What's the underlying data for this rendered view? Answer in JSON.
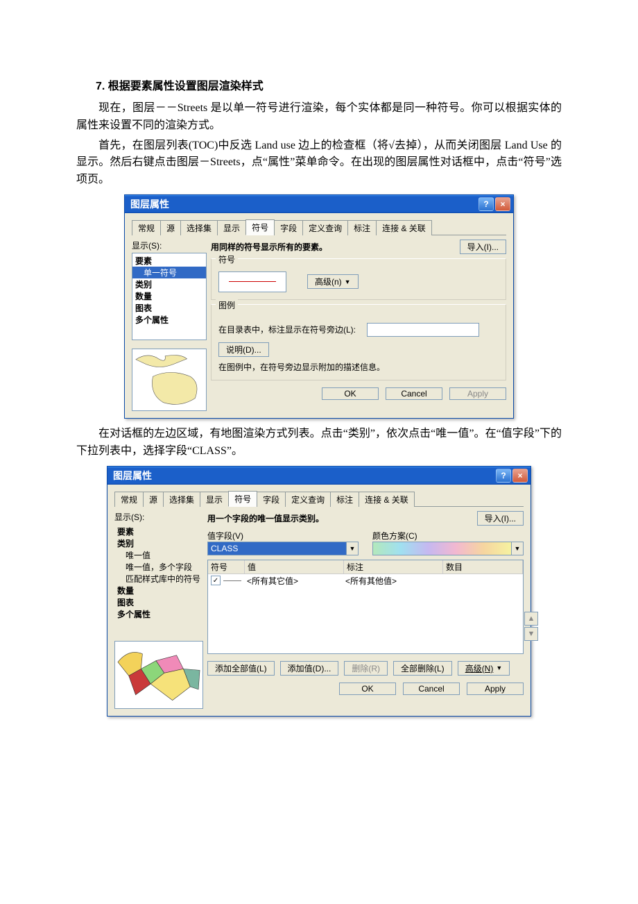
{
  "heading": "7. 根据要素属性设置图层渲染样式",
  "para1": "现在，图层－－Streets 是以单一符号进行渲染，每个实体都是同一种符号。你可以根据实体的属性来设置不同的渲染方式。",
  "para2": "首先，在图层列表(TOC)中反选 Land use 边上的检查框（将√去掉），从而关闭图层 Land Use 的显示。然后右键点击图层－Streets，点“属性”菜单命令。在出现的图层属性对话框中，点击“符号”选项页。",
  "para3": "在对话框的左边区域，有地图渲染方式列表。点击“类别”，依次点击“唯一值”。在“值字段”下的下拉列表中，选择字段“CLASS”。",
  "dialog1": {
    "title": "图层属性",
    "help": "?",
    "close": "×",
    "tabs": [
      "常规",
      "源",
      "选择集",
      "显示",
      "符号",
      "字段",
      "定义查询",
      "标注",
      "连接 & 关联"
    ],
    "active_tab": 4,
    "show_label": "显示(S):",
    "side_items": [
      "要素",
      "单一符号",
      "类别",
      "数量",
      "图表",
      "多个属性"
    ],
    "side_selected": 1,
    "desc": "用同样的符号显示所有的要素。",
    "import_btn": "导入(I)...",
    "group_symbol": "符号",
    "advanced_btn": "高级(n)",
    "group_legend": "图例",
    "legend_text": "在目录表中，标注显示在符号旁边(L):",
    "desc_btn": "说明(D)...",
    "legend_note": "在图例中，在符号旁边显示附加的描述信息。",
    "ok": "OK",
    "cancel": "Cancel",
    "apply": "Apply"
  },
  "dialog2": {
    "title": "图层属性",
    "help": "?",
    "close": "×",
    "tabs": [
      "常规",
      "源",
      "选择集",
      "显示",
      "符号",
      "字段",
      "定义查询",
      "标注",
      "连接 & 关联"
    ],
    "active_tab": 4,
    "show_label": "显示(S):",
    "side_items": [
      "要素",
      "类别",
      "唯一值",
      "唯一值，多个字段",
      "匹配样式库中的符号",
      "数量",
      "图表",
      "多个属性"
    ],
    "side_bold": [
      0,
      1,
      5,
      6,
      7
    ],
    "desc": "用一个字段的唯一值显示类别。",
    "import_btn": "导入(I)...",
    "value_field_label": "值字段(V)",
    "value_field": "CLASS",
    "color_label": "颜色方案(C)",
    "col_headers": [
      "符号",
      "值",
      "标注",
      "数目"
    ],
    "row_val": "<所有其它值>",
    "row_lab": "<所有其他值>",
    "add_all": "添加全部值(L)",
    "add_val": "添加值(D)...",
    "remove": "删除(R)",
    "remove_all": "全部删除(L)",
    "advanced": "高级(N)",
    "ok": "OK",
    "cancel": "Cancel",
    "apply": "Apply"
  }
}
